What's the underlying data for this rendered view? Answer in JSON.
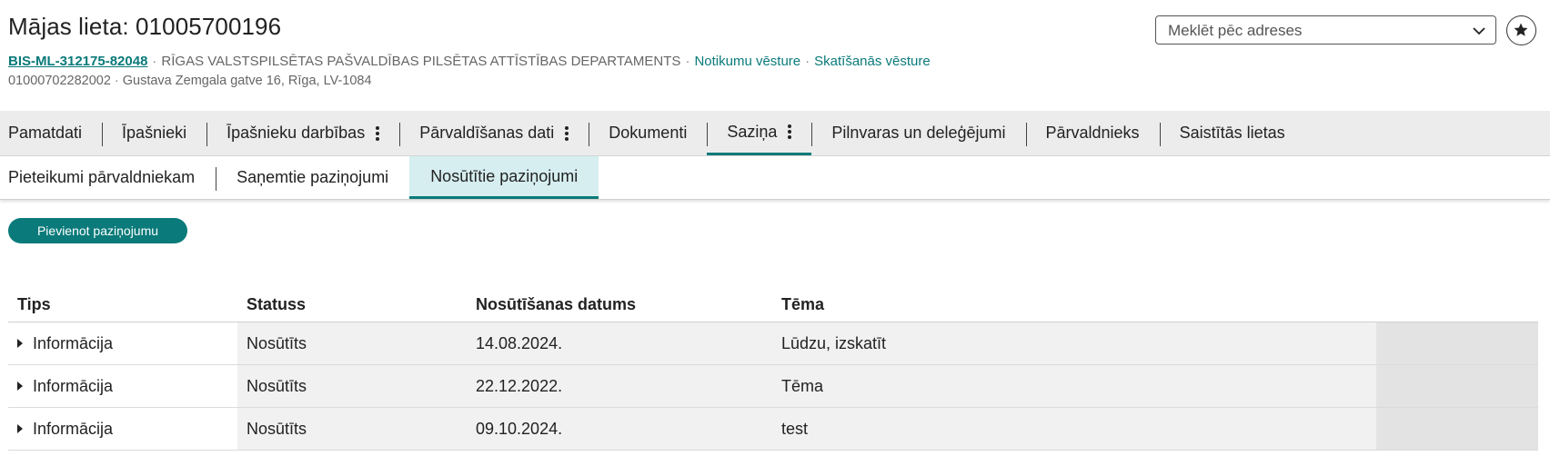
{
  "header": {
    "title": "Mājas lieta: 01005700196",
    "case_id": "BIS-ML-312175-82048",
    "department": "RĪGAS VALSTSPILSĒTAS PAŠVALDĪBAS PILSĒTAS ATTĪSTĪBAS DEPARTAMENTS",
    "link_events": "Notikumu vēsture",
    "link_views": "Skatīšanās vēsture",
    "cadastre": "01000702282002",
    "address": "Gustava Zemgala gatve 16, Rīga, LV-1084",
    "separator": "·"
  },
  "search": {
    "placeholder": "Meklēt pēc adreses",
    "icon": "chevron-down-icon"
  },
  "favorite": {
    "icon": "star-icon"
  },
  "tabs": [
    {
      "label": "Pamatdati",
      "menu": false,
      "active": false
    },
    {
      "label": "Īpašnieki",
      "menu": false,
      "active": false
    },
    {
      "label": "Īpašnieku darbības",
      "menu": true,
      "active": false
    },
    {
      "label": "Pārvaldīšanas dati",
      "menu": true,
      "active": false
    },
    {
      "label": "Dokumenti",
      "menu": false,
      "active": false
    },
    {
      "label": "Saziņa",
      "menu": true,
      "active": true
    },
    {
      "label": "Pilnvaras un deleģējumi",
      "menu": false,
      "active": false
    },
    {
      "label": "Pārvaldnieks",
      "menu": false,
      "active": false
    },
    {
      "label": "Saistītās lietas",
      "menu": false,
      "active": false
    }
  ],
  "subtabs": [
    {
      "label": "Pieteikumi pārvaldniekam",
      "active": false
    },
    {
      "label": "Saņemtie paziņojumi",
      "active": false
    },
    {
      "label": "Nosūtītie paziņojumi",
      "active": true
    }
  ],
  "actions": {
    "add_label": "Pievienot paziņojumu"
  },
  "table": {
    "columns": [
      "Tips",
      "Statuss",
      "Nosūtīšanas datums",
      "Tēma"
    ],
    "rows": [
      {
        "type": "Informācija",
        "status": "Nosūtīts",
        "date": "14.08.2024.",
        "subject": "Lūdzu, izskatīt"
      },
      {
        "type": "Informācija",
        "status": "Nosūtīts",
        "date": "22.12.2022.",
        "subject": "Tēma"
      },
      {
        "type": "Informācija",
        "status": "Nosūtīts",
        "date": "09.10.2024.",
        "subject": "test"
      }
    ]
  },
  "colors": {
    "accent": "#0a7a7a",
    "active_subtab_bg": "#d6eef0",
    "tabbar_bg": "#ececec"
  }
}
